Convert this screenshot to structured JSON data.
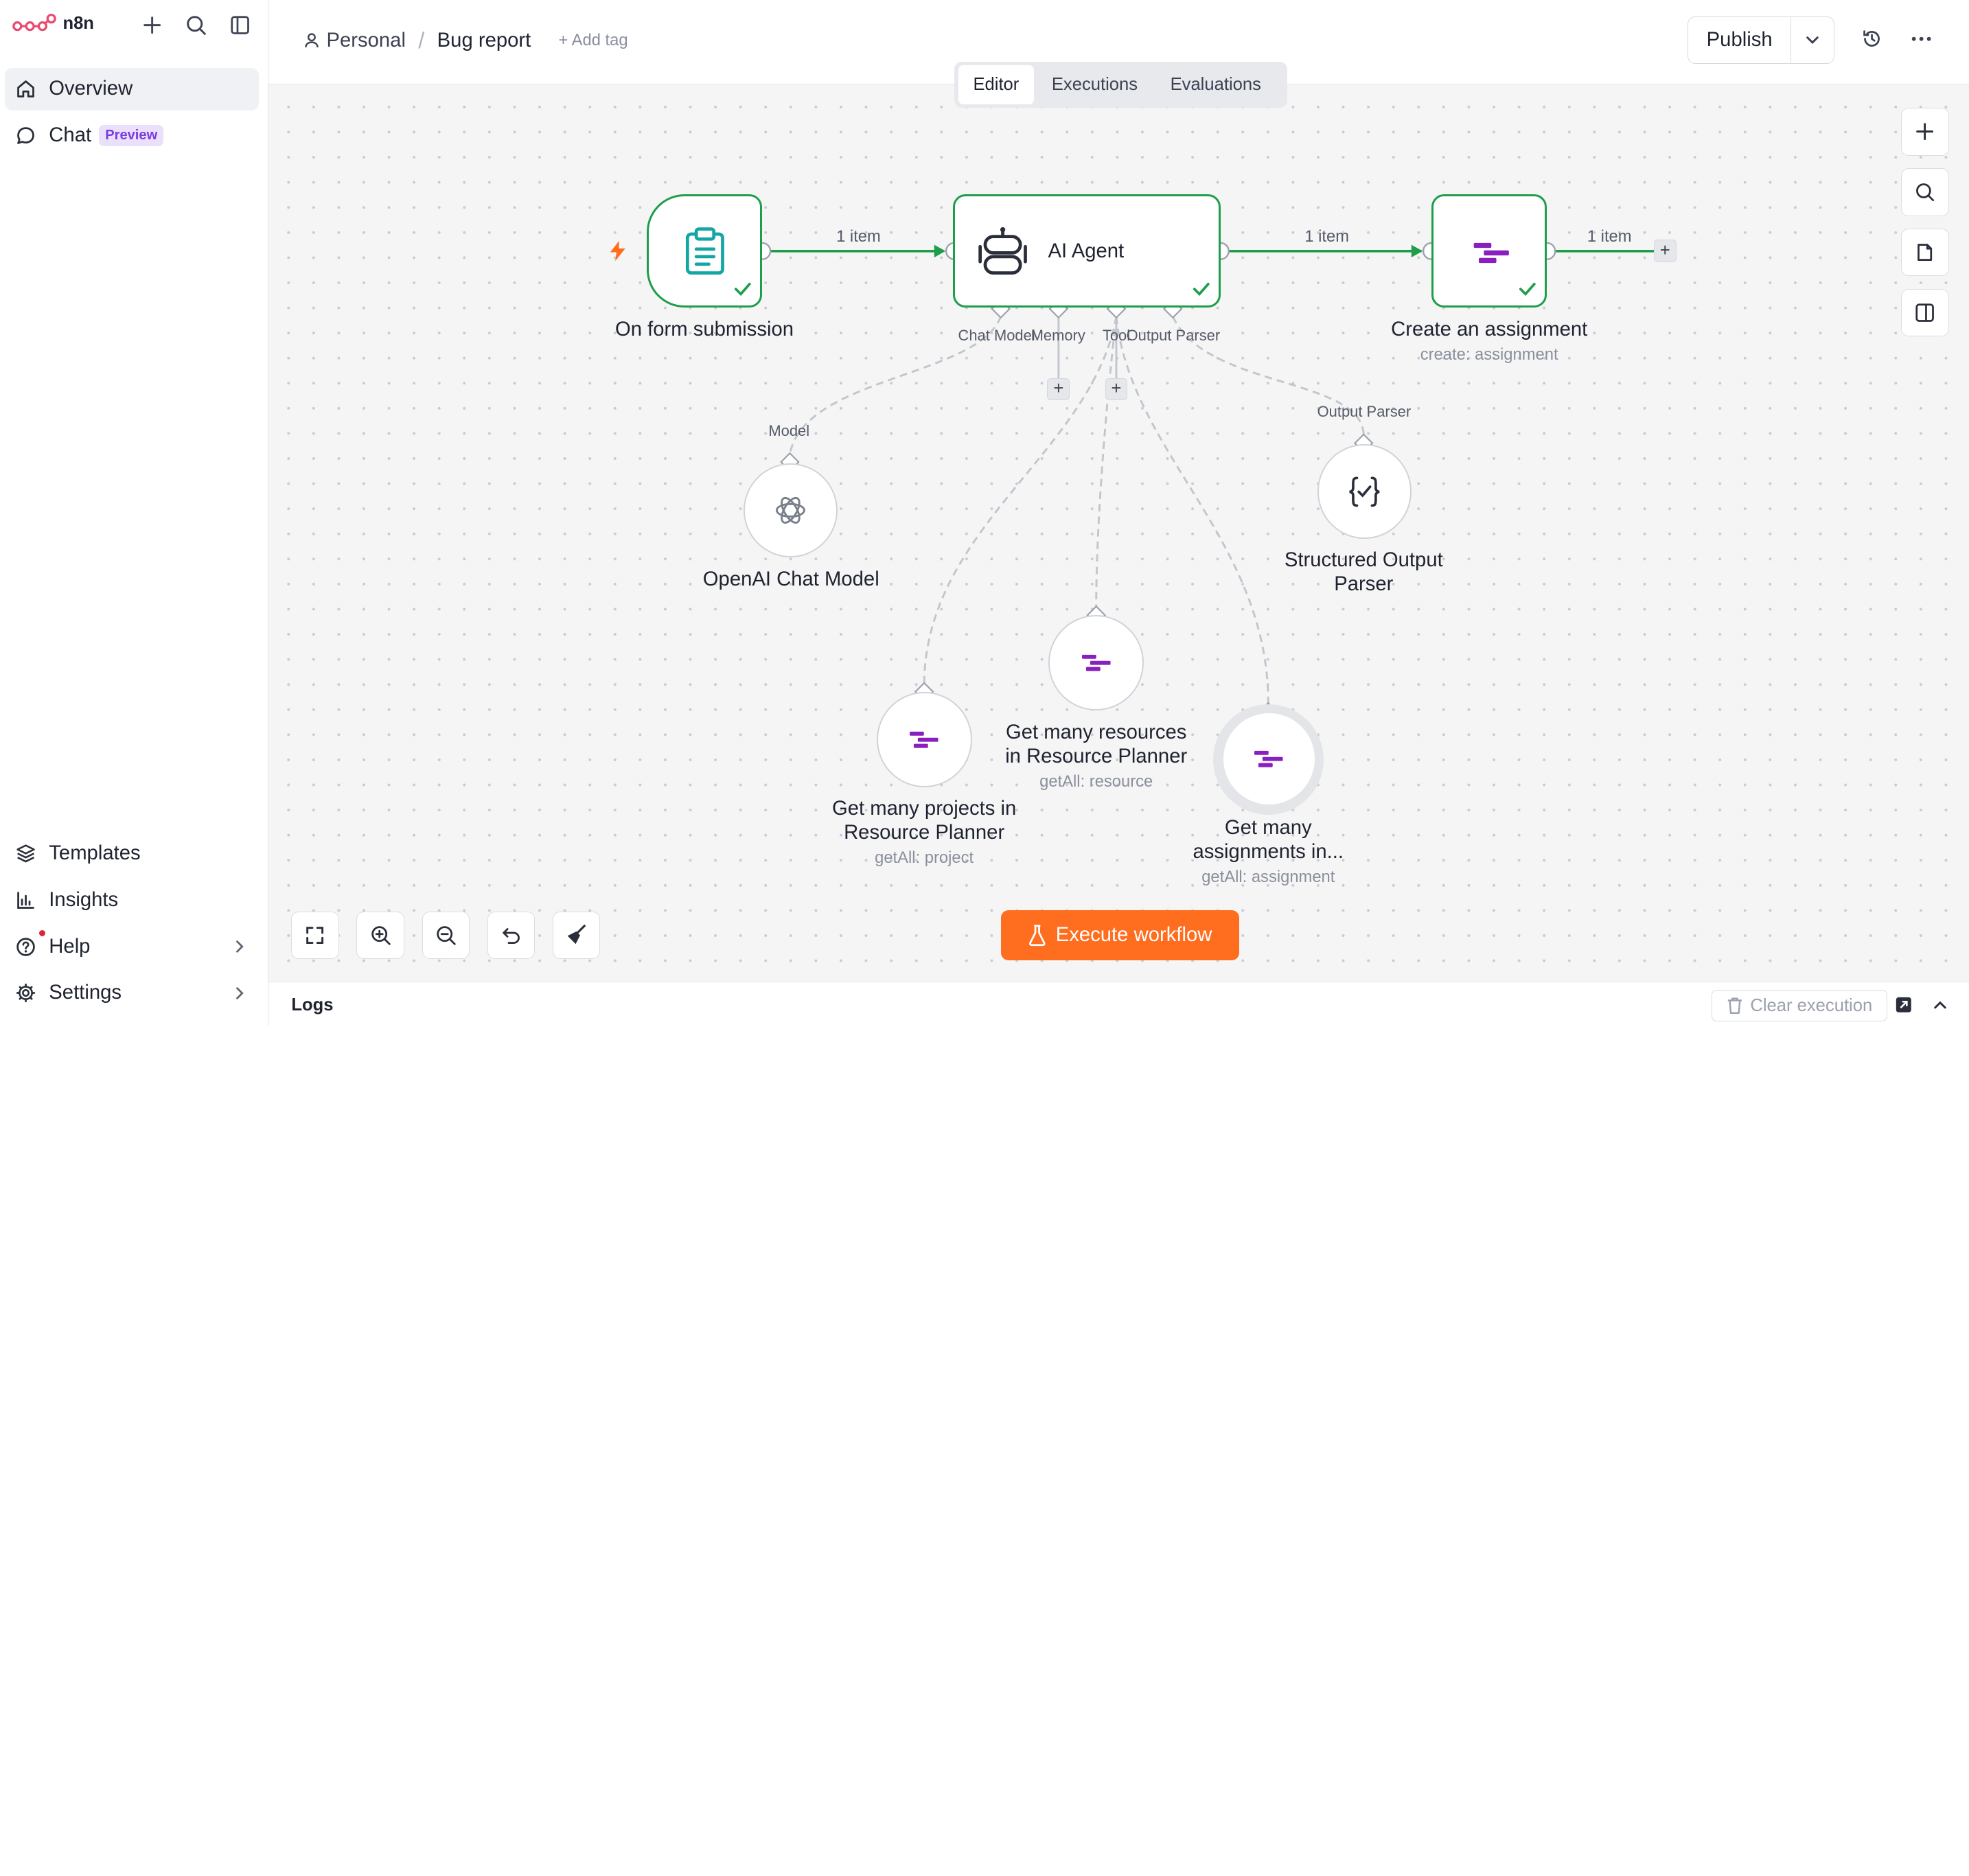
{
  "sidebar": {
    "app_name": "n8n",
    "nav": [
      {
        "label": "Overview",
        "icon": "home-icon"
      },
      {
        "label": "Chat",
        "icon": "chat-icon",
        "badge": "Preview"
      }
    ],
    "bottom": [
      {
        "label": "Templates",
        "icon": "templates-icon"
      },
      {
        "label": "Insights",
        "icon": "insights-icon"
      },
      {
        "label": "Help",
        "icon": "help-icon"
      },
      {
        "label": "Settings",
        "icon": "settings-icon"
      }
    ]
  },
  "header": {
    "project": "Personal",
    "workflow_name": "Bug report",
    "add_tag": "+ Add tag",
    "publish": "Publish"
  },
  "tabs": [
    "Editor",
    "Executions",
    "Evaluations"
  ],
  "nodes": {
    "trigger": {
      "label": "On form submission"
    },
    "agent": {
      "label": "AI Agent",
      "ports": [
        "Chat Model",
        "Memory",
        "Tool",
        "Output Parser"
      ]
    },
    "create": {
      "label": "Create an assignment",
      "sub": "create: assignment"
    },
    "openai": {
      "label": "OpenAI Chat Model",
      "port": "Model"
    },
    "parser": {
      "label_line1": "Structured Output",
      "label_line2": "Parser",
      "port": "Output Parser"
    },
    "projects": {
      "label_line1": "Get many projects in",
      "label_line2": "Resource Planner",
      "sub": "getAll: project"
    },
    "resources": {
      "label_line1": "Get many resources",
      "label_line2": "in Resource Planner",
      "sub": "getAll: resource"
    },
    "assignments": {
      "label_line1": "Get many",
      "label_line2": "assignments in...",
      "sub": "getAll: assignment"
    }
  },
  "connections": {
    "trigger_to_agent": "1 item",
    "agent_to_create": "1 item",
    "create_out": "1 item"
  },
  "execute_button": "Execute workflow",
  "logs": {
    "title": "Logs",
    "clear": "Clear execution"
  },
  "colors": {
    "accent": "#ff6d1f",
    "success": "#1e9e4b",
    "resource_planner": "#8a1fc0",
    "form": "#14a5a5"
  }
}
